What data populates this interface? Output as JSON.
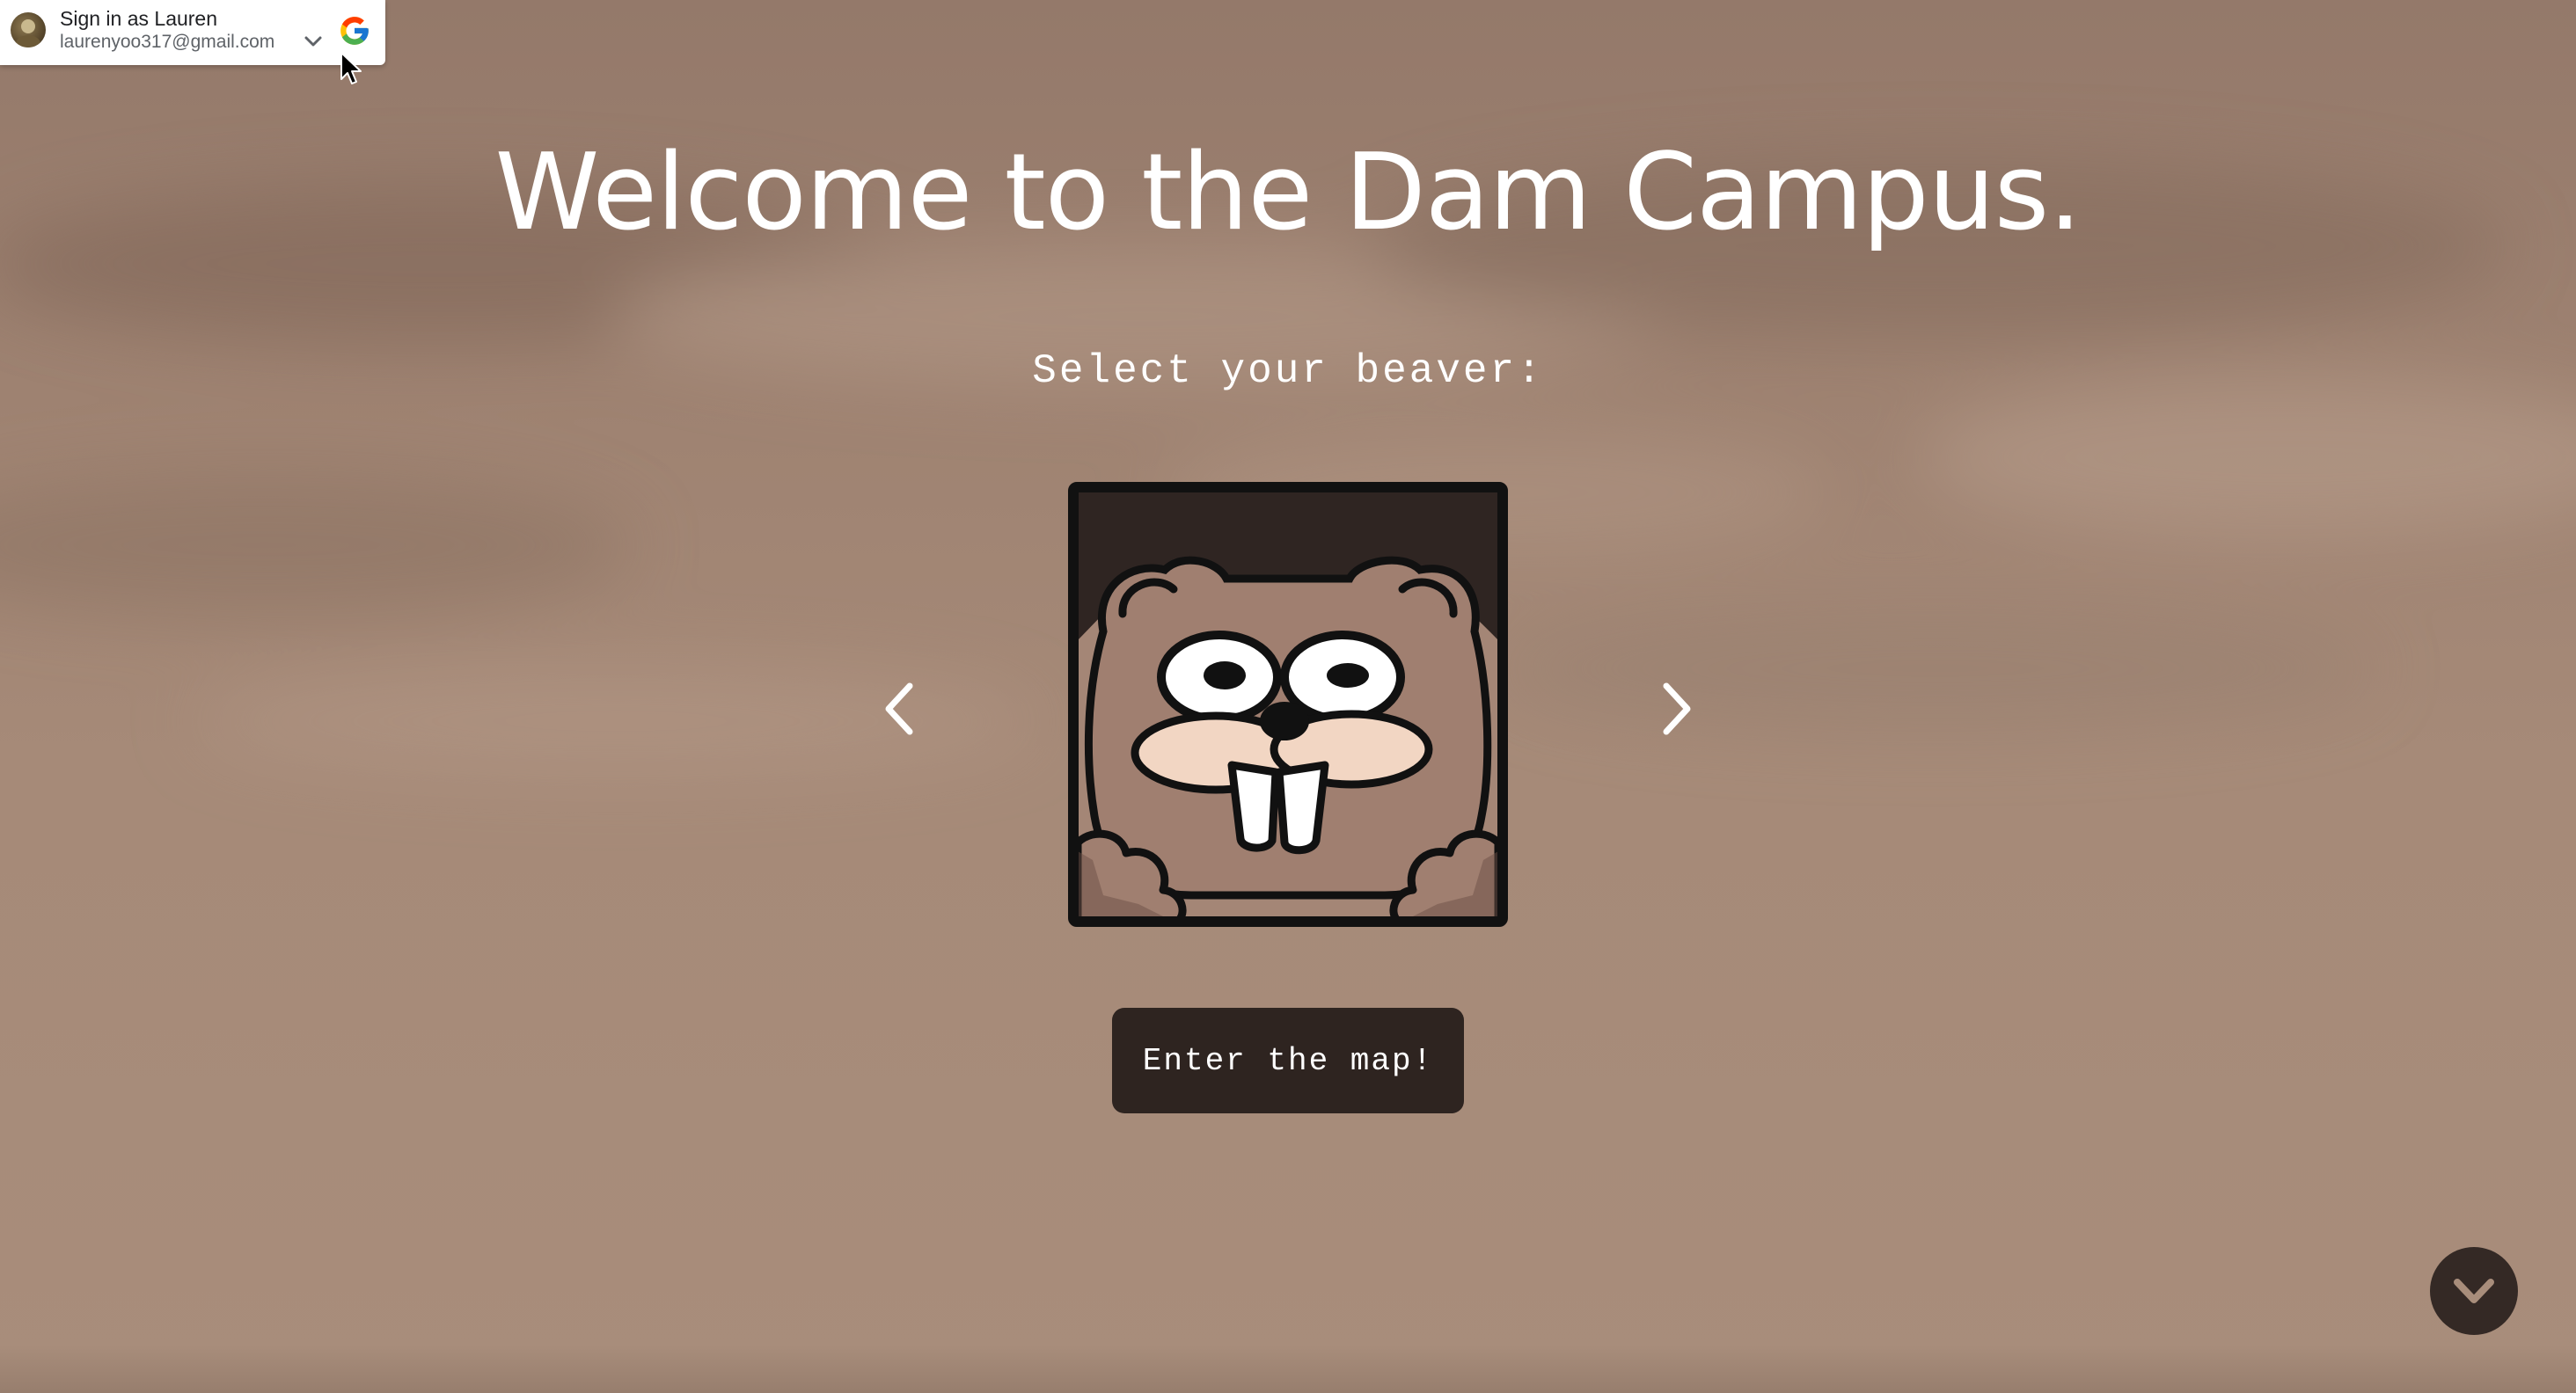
{
  "signin": {
    "title": "Sign in as Lauren",
    "email": "laurenyoo317@gmail.com",
    "avatar_icon": "user-avatar",
    "chevron_icon": "chevron-down-icon",
    "provider_icon": "google-logo-icon"
  },
  "main": {
    "headline": "Welcome to the Dam Campus.",
    "subhead": "Select your beaver:",
    "selected_character": "beaver-avatar",
    "prev_icon": "chevron-left-icon",
    "next_icon": "chevron-right-icon",
    "enter_label": "Enter the map!"
  },
  "scroll_button": {
    "icon": "chevron-down-icon"
  },
  "colors": {
    "background": "#a68a78",
    "button": "#2e2420",
    "text": "#ffffff"
  }
}
